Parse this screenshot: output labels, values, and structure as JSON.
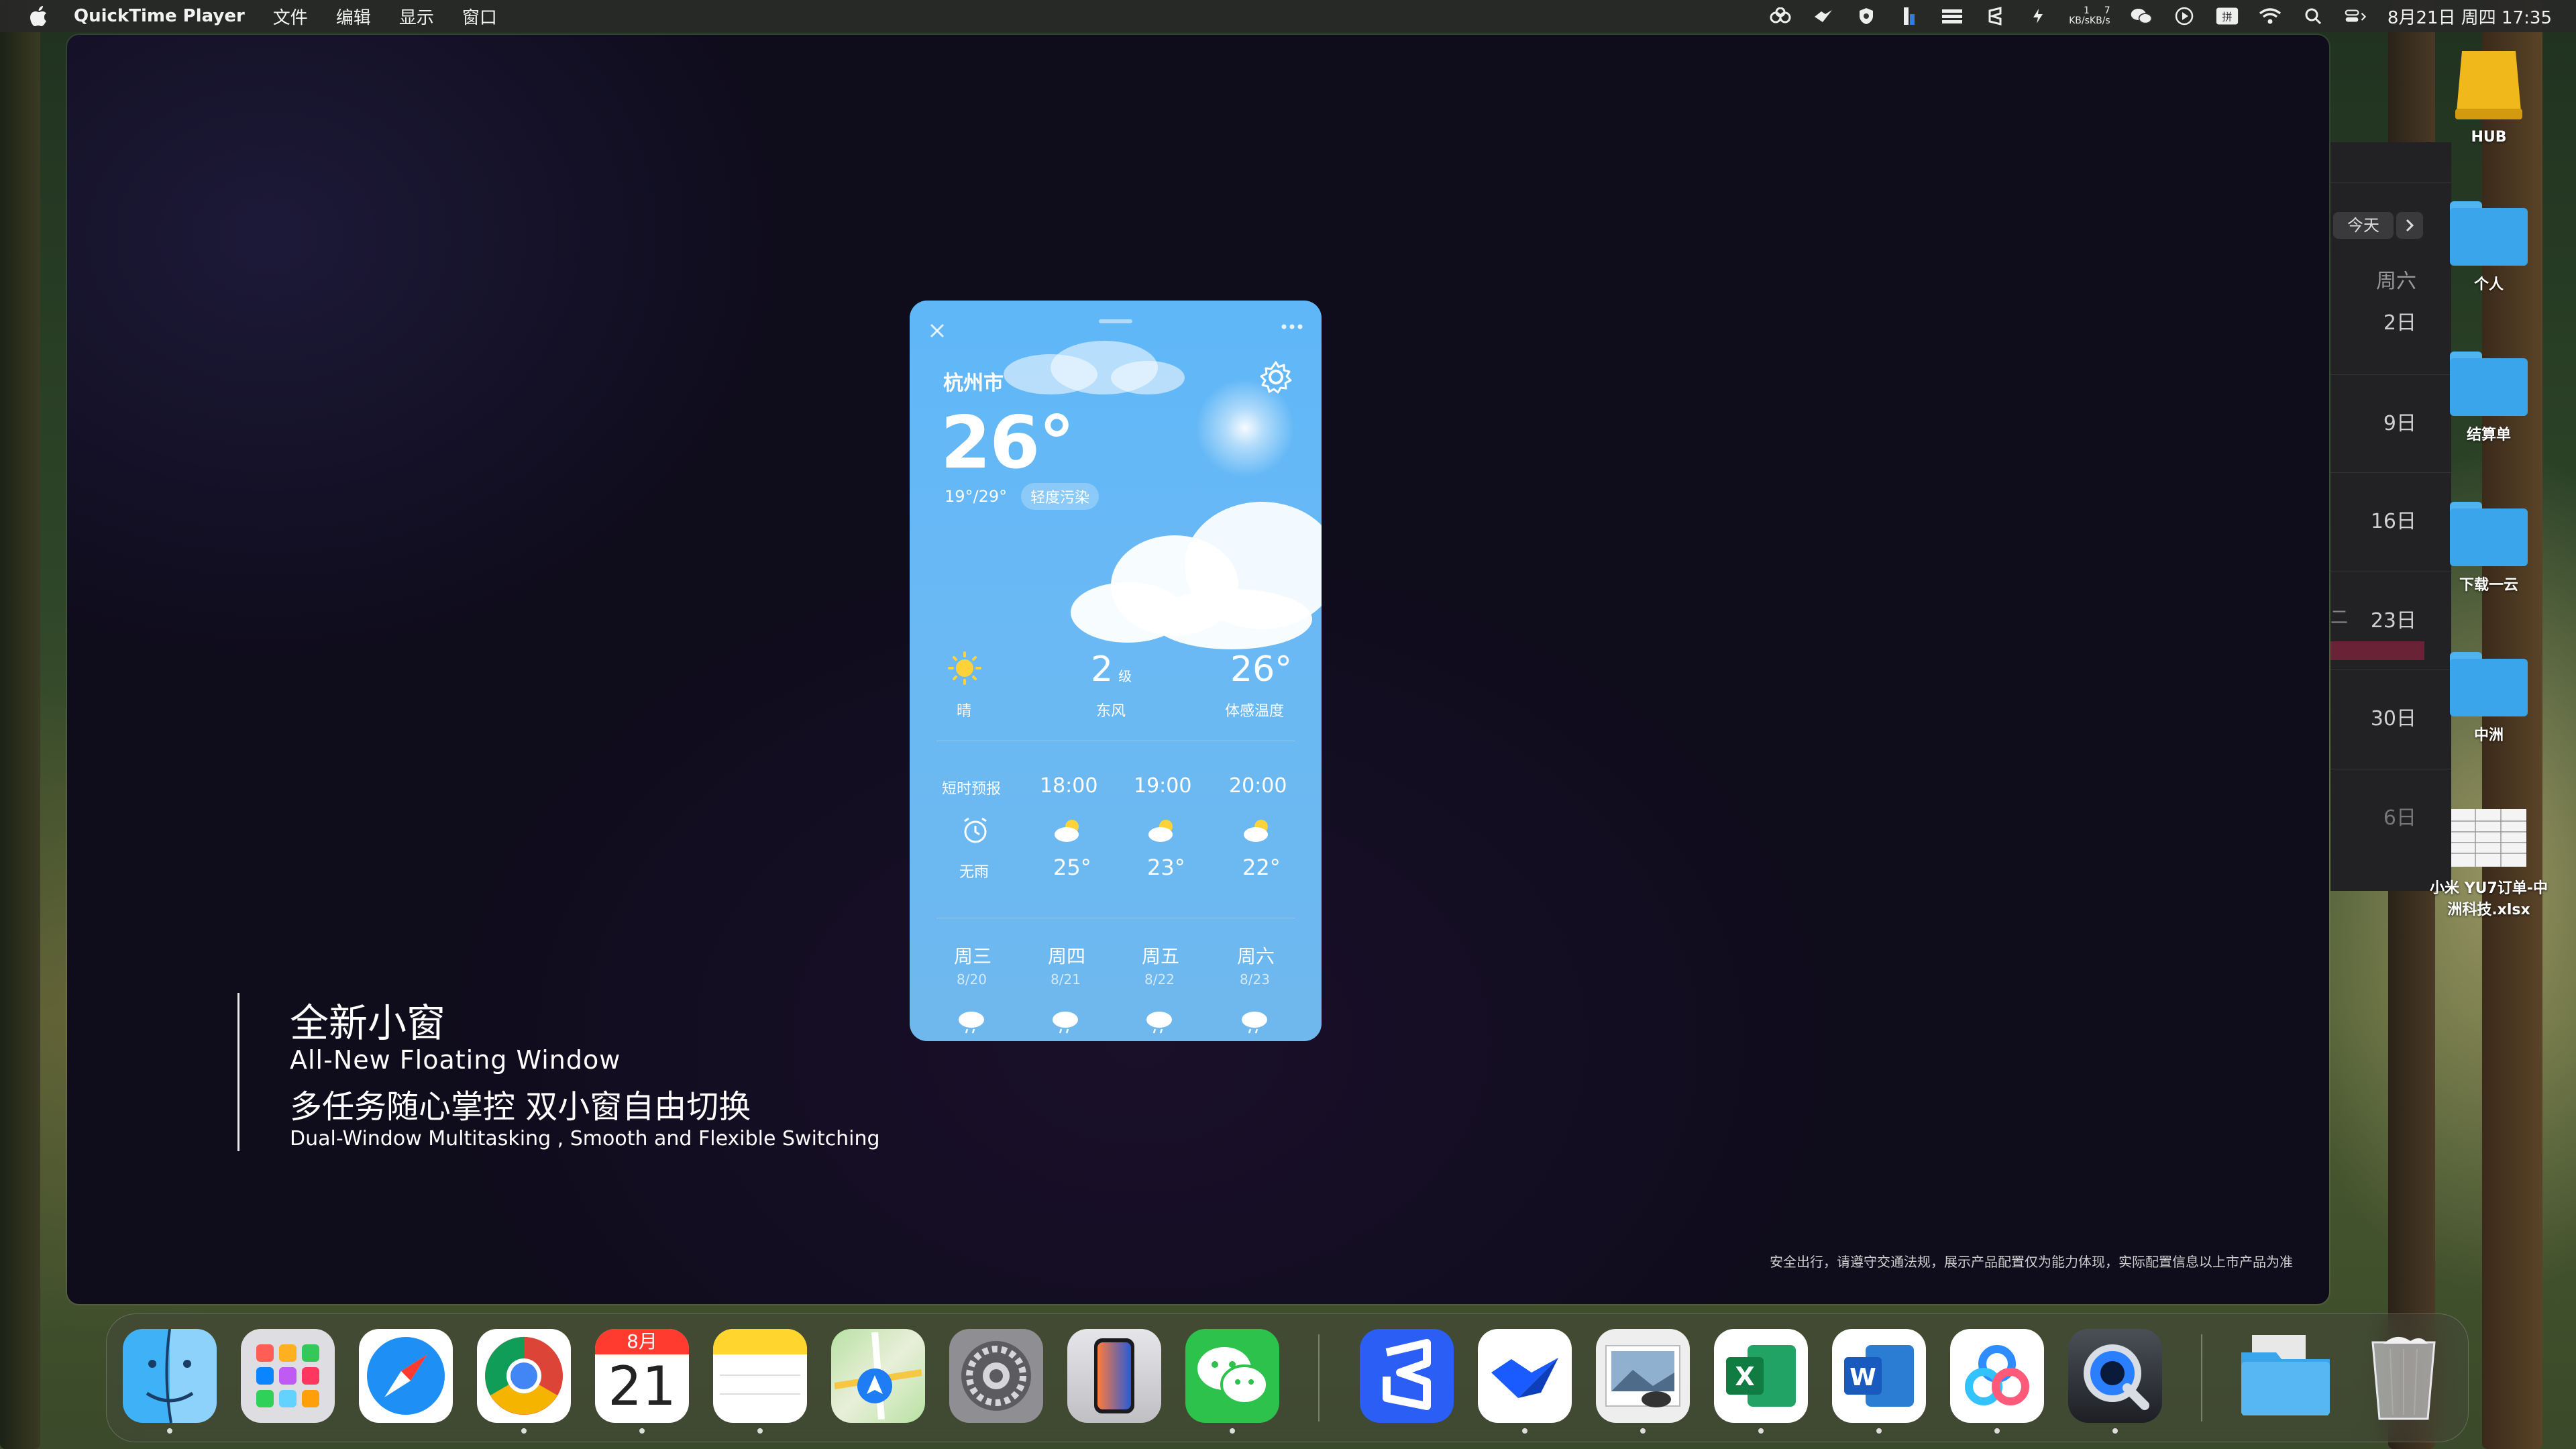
{
  "menubar": {
    "app_name": "QuickTime Player",
    "menus": [
      "文件",
      "编辑",
      "显示",
      "窗口"
    ],
    "net_up": "1 KB/s",
    "net_down": "7 KB/s",
    "datetime": "8月21日 周四  17:35"
  },
  "video": {
    "caption_title_cn": "全新小窗",
    "caption_title_en": "All-New Floating Window",
    "caption_sub_cn": "多任务随心掌控 双小窗自由切换",
    "caption_sub_en": "Dual-Window Multitasking , Smooth and Flexible Switching",
    "disclaimer": "安全出行，请遵守交通法规，展示产品配置仅为能力体现，实际配置信息以上市产品为准"
  },
  "weather": {
    "city": "杭州市",
    "temp": "26°",
    "range": "19°/29°",
    "aqi": "轻度污染",
    "now": [
      {
        "value": "",
        "label": "晴",
        "icon": "sun-icon"
      },
      {
        "value": "2",
        "unit": "级",
        "label": "东风"
      },
      {
        "value": "26°",
        "label": "体感温度"
      }
    ],
    "hourly_header": "短时预报",
    "hourly_first_label": "无雨",
    "hours": [
      {
        "time": "18:00",
        "temp": "25°"
      },
      {
        "time": "19:00",
        "temp": "23°"
      },
      {
        "time": "20:00",
        "temp": "22°"
      }
    ],
    "days": [
      {
        "day": "周三",
        "date": "8/20"
      },
      {
        "day": "周四",
        "date": "8/21"
      },
      {
        "day": "周五",
        "date": "8/22"
      },
      {
        "day": "周六",
        "date": "8/23"
      }
    ]
  },
  "calendar": {
    "today_button": "今天",
    "weekday": "周六",
    "dates": [
      "2日",
      "9日",
      "16日",
      "23日",
      "30日",
      "6日"
    ],
    "row_label": "二"
  },
  "desktop_icons": [
    {
      "label": "HUB",
      "type": "drive"
    },
    {
      "label": "个人",
      "type": "folder"
    },
    {
      "label": "结算单",
      "type": "folder"
    },
    {
      "label": "下载一云",
      "type": "folder"
    },
    {
      "label": "中洲",
      "type": "folder"
    },
    {
      "label": "小米 YU7订单-中洲科技.xlsx",
      "type": "file"
    }
  ],
  "dock": {
    "calendar_month": "8月",
    "calendar_day": "21",
    "apps": [
      "finder",
      "launchpad",
      "safari",
      "chrome",
      "calendar",
      "notes",
      "maps",
      "system-settings",
      "iphone-mirroring",
      "wechat",
      "app-s",
      "feishu",
      "preview",
      "excel",
      "word",
      "baidu-netdisk",
      "quicktime",
      "downloads",
      "trash"
    ]
  }
}
